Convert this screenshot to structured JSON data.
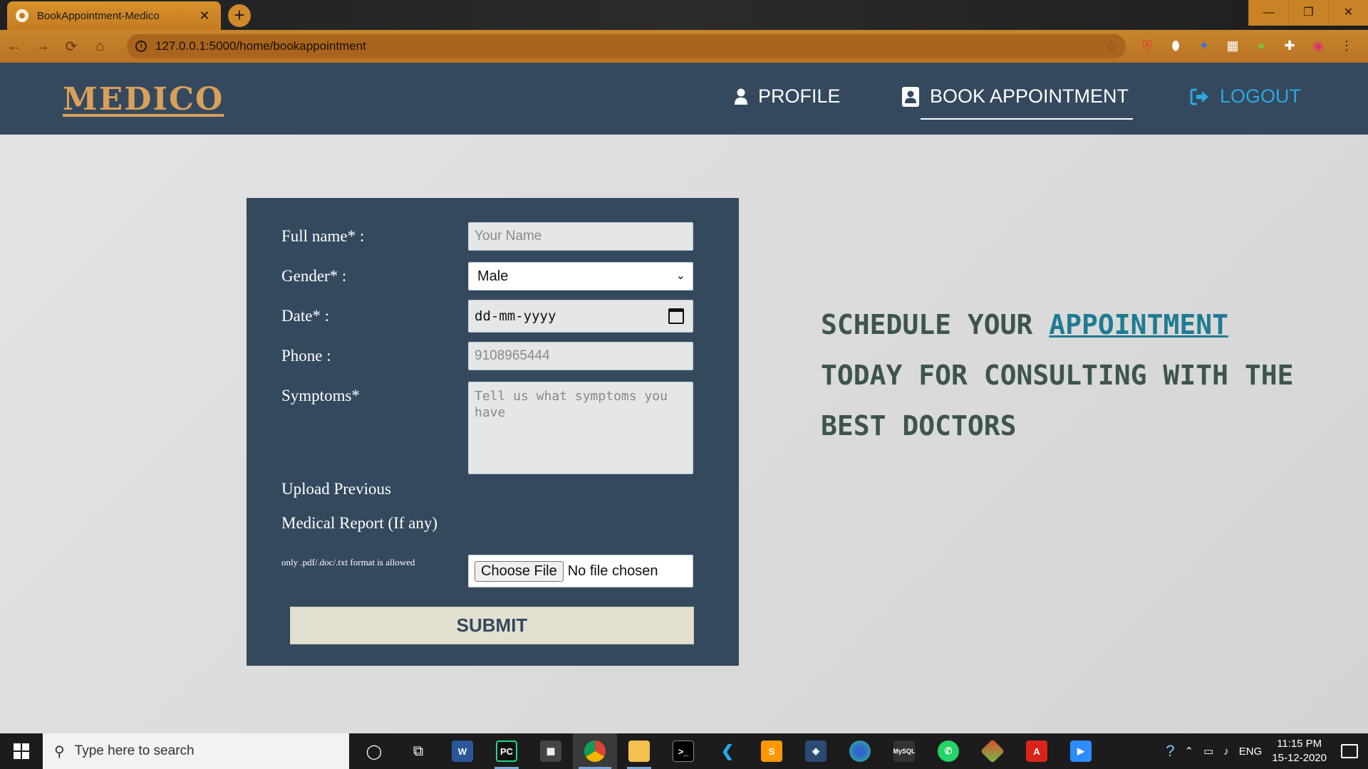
{
  "browser": {
    "tab_title": "BookAppointment-Medico",
    "tab_close": "✕",
    "new_tab": "+",
    "url": "127.0.0.1:5000/home/bookappointment",
    "window_buttons": [
      "—",
      "❐",
      "✕"
    ],
    "nav_icons": [
      "←",
      "→",
      "⟳",
      "⌂"
    ]
  },
  "site": {
    "logo": "MEDICO",
    "nav": {
      "profile": "PROFILE",
      "book": "BOOK APPOINTMENT",
      "logout": "LOGOUT"
    }
  },
  "form": {
    "full_name_label": "Full name* :",
    "full_name_placeholder": "Your Name",
    "gender_label": "Gender* :",
    "gender_value": "Male",
    "date_label": "Date* :",
    "date_placeholder": "dd-mm-yyyy",
    "phone_label": "Phone :",
    "phone_placeholder": "9108965444",
    "symptoms_label": "Symptoms*",
    "symptoms_placeholder": "Tell us what symptoms you have",
    "upload_label_1": "Upload Previous",
    "upload_label_2": "Medical Report (If any)",
    "upload_note": "only .pdf/.doc/.txt format is allowed",
    "choose_file": "Choose File",
    "no_file": "No file chosen",
    "submit": "SUBMIT"
  },
  "tagline": {
    "before": "SCHEDULE YOUR ",
    "highlight": "APPOINTMENT",
    "after": " TODAY FOR CONSULTING WITH THE BEST DOCTORS"
  },
  "taskbar": {
    "search_placeholder": "Type here to search",
    "language": "ENG",
    "time": "11:15 PM",
    "date": "15-12-2020"
  },
  "colors": {
    "header_bg": "#34495e",
    "logo": "#d9a05b",
    "logout": "#2ba8e0",
    "tagline": "#3d5450",
    "tagline_highlight": "#1f7b93",
    "submit_bg": "#e3e0d0"
  }
}
